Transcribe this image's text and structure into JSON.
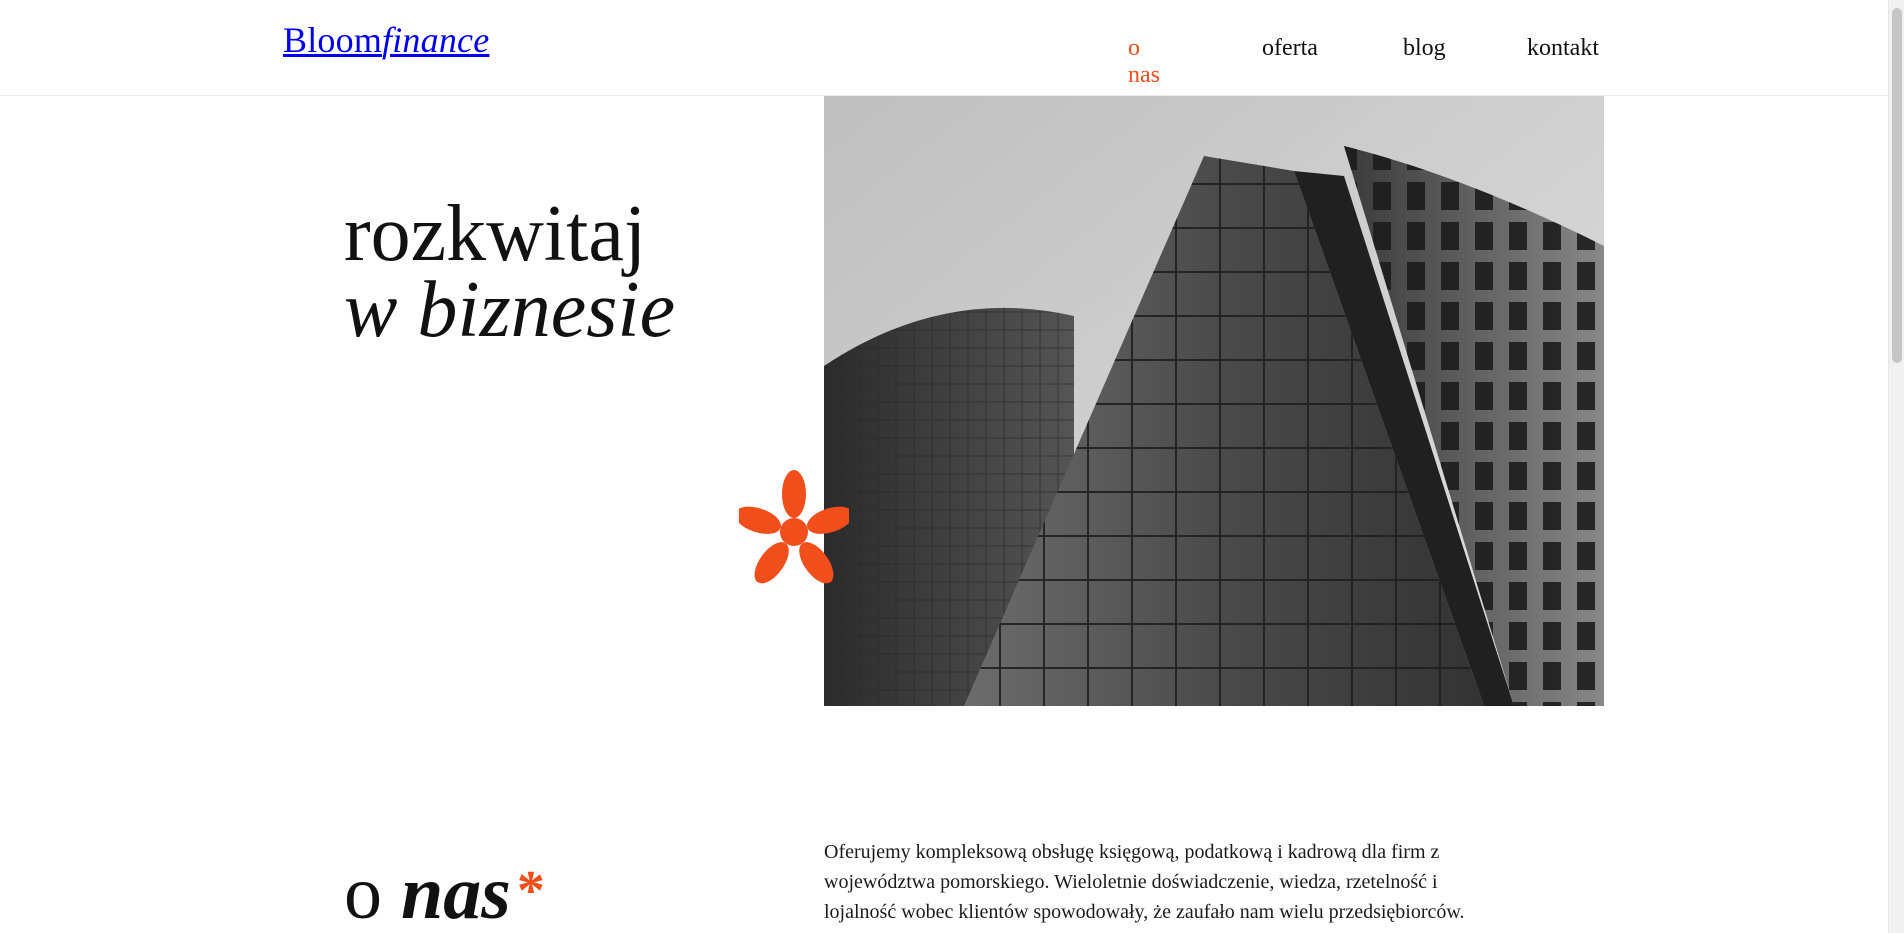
{
  "brand": {
    "name": "Bloom",
    "italic": "finance"
  },
  "nav": {
    "items": [
      {
        "label": "o nas",
        "active": true
      },
      {
        "label": "oferta",
        "active": false
      },
      {
        "label": "blog",
        "active": false
      },
      {
        "label": "kontakt",
        "active": false
      }
    ]
  },
  "hero": {
    "line1": "rozkwitaj",
    "line2": "w biznesie",
    "image_alt": "",
    "asterisk": "*"
  },
  "about": {
    "heading_o": "o",
    "heading_nas": "nas",
    "asterisk": "*",
    "text": "Oferujemy kompleksową obsługę księgową, podatkową i kadrową dla firm z województwa pomorskiego. Wieloletnie doświadczenie, wiedza, rzetelność i lojalność wobec klientów spowodowały, że zaufało nam wielu przedsiębiorców."
  },
  "colors": {
    "accent": "#f04e1a",
    "text": "#111111",
    "line": "#ececec"
  }
}
